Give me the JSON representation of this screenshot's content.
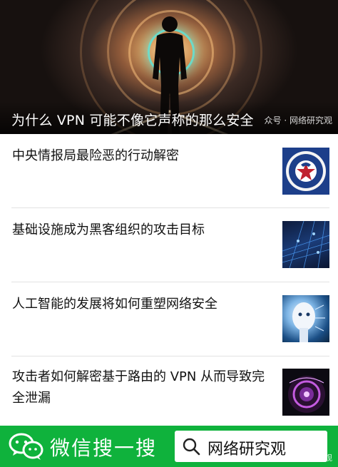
{
  "hero": {
    "title": "为什么 VPN 可能不像它声称的那么安全",
    "source": "众号 · 网络研究观"
  },
  "articles": [
    {
      "title": "中央情报局最险恶的行动解密",
      "thumb_icon": "cia-seal-icon"
    },
    {
      "title": "基础设施成为黑客组织的攻击目标",
      "thumb_icon": "network-grid-icon"
    },
    {
      "title": "人工智能的发展将如何重塑网络安全",
      "thumb_icon": "robot-face-icon"
    },
    {
      "title": "攻击者如何解密基于路由的 VPN 从而导致完全泄漏",
      "thumb_icon": "purple-lens-icon"
    }
  ],
  "bottom_bar": {
    "label": "微信搜一搜",
    "search_query": "网络研究观",
    "watermark": "CSDN @网络研究观",
    "color": "#0fb23c"
  }
}
